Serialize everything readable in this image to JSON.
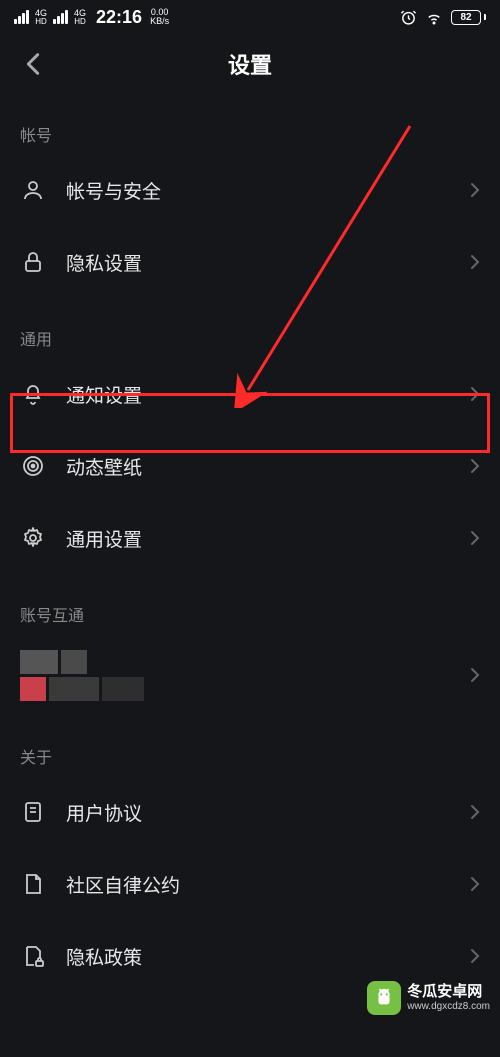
{
  "statusBar": {
    "networkLabel1": "4G HD",
    "networkLabel2": "4G HD",
    "time": "22:16",
    "speedValue": "0.00",
    "speedUnit": "KB/s",
    "battery": "82"
  },
  "navbar": {
    "title": "设置"
  },
  "sections": {
    "account": {
      "header": "帐号",
      "items": [
        {
          "label": "帐号与安全"
        },
        {
          "label": "隐私设置"
        }
      ]
    },
    "general": {
      "header": "通用",
      "items": [
        {
          "label": "通知设置"
        },
        {
          "label": "动态壁纸"
        },
        {
          "label": "通用设置"
        }
      ]
    },
    "interconnect": {
      "header": "账号互通"
    },
    "about": {
      "header": "关于",
      "items": [
        {
          "label": "用户协议"
        },
        {
          "label": "社区自律公约"
        },
        {
          "label": "隐私政策"
        }
      ]
    }
  },
  "watermark": {
    "name": "冬瓜安卓网",
    "url": "www.dgxcdz8.com"
  },
  "annotation": {
    "highlightColor": "#ff2a2a"
  }
}
